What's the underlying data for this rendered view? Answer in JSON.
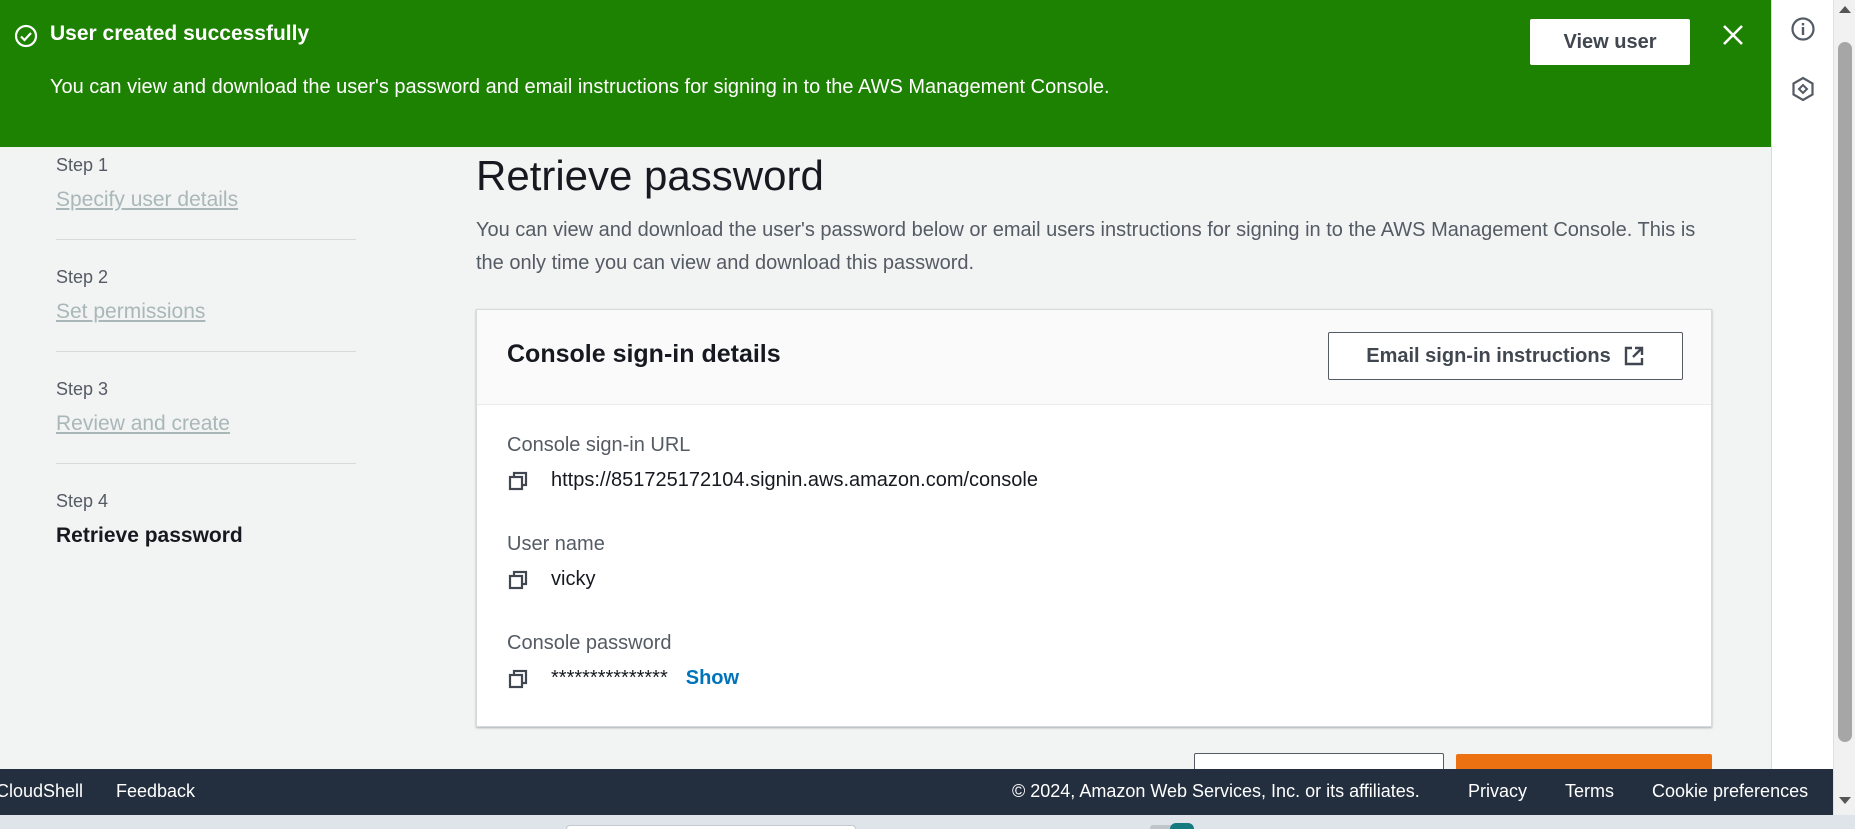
{
  "flash": {
    "title": "User created successfully",
    "message": "You can view and download the user's password and email instructions for signing in to the AWS Management Console.",
    "view_button": "View user",
    "color": "#1d8102"
  },
  "steps": [
    {
      "num": "Step 1",
      "label": "Specify user details"
    },
    {
      "num": "Step 2",
      "label": "Set permissions"
    },
    {
      "num": "Step 3",
      "label": "Review and create"
    },
    {
      "num": "Step 4",
      "label": "Retrieve password"
    }
  ],
  "main": {
    "title": "Retrieve password",
    "description": "You can view and download the user's password below or email users instructions for signing in to the AWS Management Console. This is the only time you can view and download this password."
  },
  "panel": {
    "title": "Console sign-in details",
    "email_button": "Email sign-in instructions",
    "url_label": "Console sign-in URL",
    "url_value": "https://851725172104.signin.aws.amazon.com/console",
    "username_label": "User name",
    "username_value": "vicky",
    "password_label": "Console password",
    "password_value": "***************",
    "show_link": "Show"
  },
  "footer": {
    "cloudshell": "CloudShell",
    "feedback": "Feedback",
    "copyright": "© 2024, Amazon Web Services, Inc. or its affiliates.",
    "privacy": "Privacy",
    "terms": "Terms",
    "cookies": "Cookie preferences"
  },
  "icons": {
    "success": "check-circle-icon",
    "close": "close-icon",
    "external": "external-link-icon",
    "copy": "copy-icon",
    "info": "info-icon",
    "hex": "hexagon-icon"
  }
}
